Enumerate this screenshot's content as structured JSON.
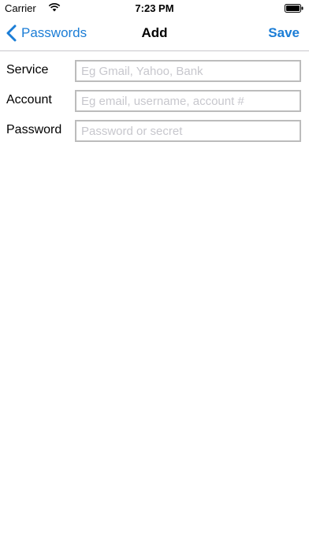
{
  "status_bar": {
    "carrier": "Carrier",
    "time": "7:23 PM",
    "icons": [
      "wifi-icon",
      "battery-icon"
    ]
  },
  "nav": {
    "back_label": "Passwords",
    "title": "Add",
    "save_label": "Save",
    "accent_color": "#1b7dd6"
  },
  "form": {
    "fields": [
      {
        "label": "Service",
        "value": "",
        "placeholder": "Eg Gmail, Yahoo, Bank"
      },
      {
        "label": "Account",
        "value": "",
        "placeholder": "Eg email, username, account #"
      },
      {
        "label": "Password",
        "value": "",
        "placeholder": "Password or secret"
      }
    ]
  }
}
